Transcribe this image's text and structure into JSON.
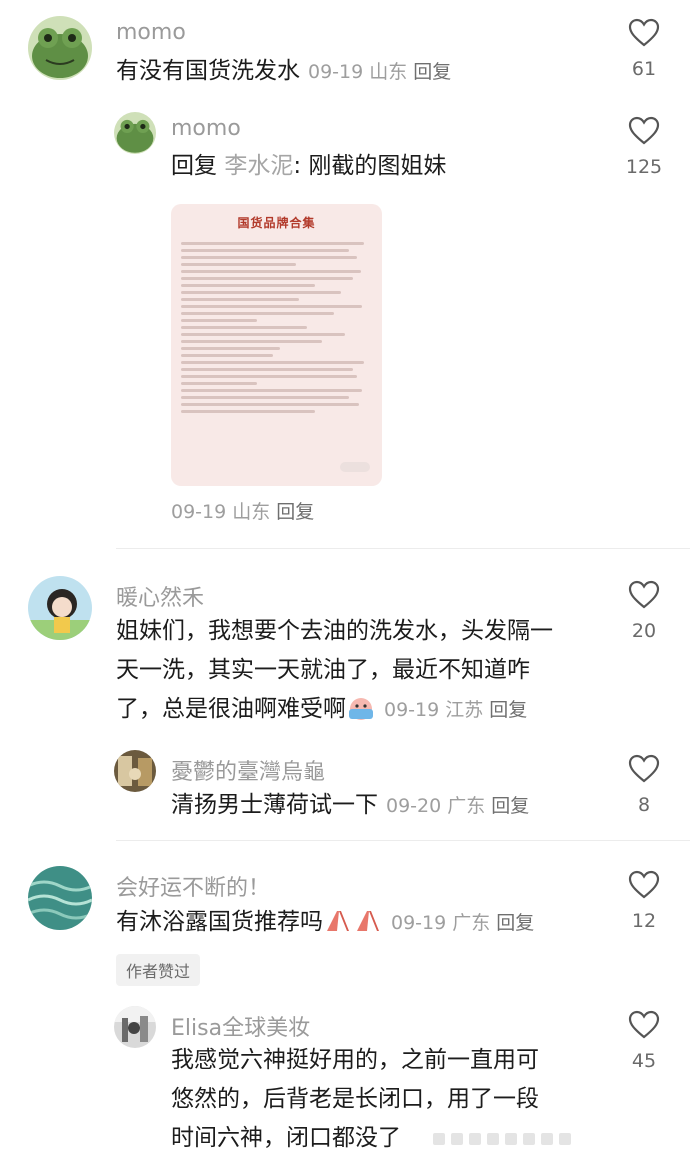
{
  "comments": [
    {
      "username": "momo",
      "text": "有没有国货洗发水",
      "date": "09-19",
      "location": "山东",
      "reply_label": "回复",
      "likes": "61",
      "avatar_icon": "frog-avatar-icon"
    },
    {
      "username": "momo",
      "reply_prefix": "回复",
      "reply_to": "李水泥",
      "text": ": 刚截的图姐妹",
      "date": "09-19",
      "location": "山东",
      "reply_label": "回复",
      "likes": "125",
      "avatar_icon": "frog-avatar-icon",
      "image_title": "国货品牌合集"
    },
    {
      "username": "暖心然禾",
      "text_lines": [
        "姐妹们，我想要个去油的洗发水，头发隔一",
        "天一洗，其实一天就油了，最近不知道咋",
        "了，总是很油啊难受啊"
      ],
      "emoji_icon": "crying-emoji-icon",
      "date": "09-19",
      "location": "江苏",
      "reply_label": "回复",
      "likes": "20",
      "avatar_icon": "anime-girl-avatar-icon"
    },
    {
      "username": "憂鬱的臺灣烏龜",
      "text": "清扬男士薄荷试一下",
      "date": "09-20",
      "location": "广东",
      "reply_label": "回复",
      "likes": "8",
      "avatar_icon": "photo-avatar-icon"
    },
    {
      "username": "会好运不断的！",
      "text": "有沐浴露国货推荐吗",
      "emoji_icon": "pray-hands-icon",
      "date": "09-19",
      "location": "广东",
      "reply_label": "回复",
      "likes": "12",
      "badge": "作者赞过",
      "avatar_icon": "water-avatar-icon"
    },
    {
      "username": "Elisa全球美妆",
      "text_lines": [
        "我感觉六神挺好用的，之前一直用可",
        "悠然的，后背老是长闭口，用了一段",
        "时间六神，闭口都没了"
      ],
      "likes": "45",
      "avatar_icon": "photo-avatar-icon"
    }
  ],
  "colors": {
    "accent_title": "#b23a2b",
    "username_gray": "#9a9a9a",
    "meta_gray": "#9e9e9e"
  }
}
